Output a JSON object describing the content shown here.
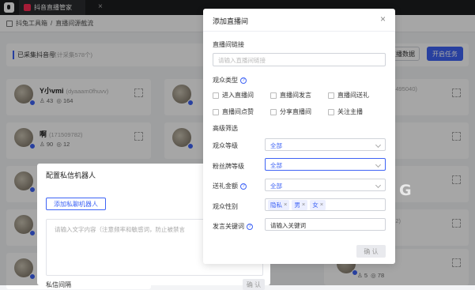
{
  "app": {
    "tab_title": "抖音直播管家",
    "close_label": "×"
  },
  "breadcrumb": {
    "root": "抖兔工具箱",
    "separator": "/",
    "current": "直播间源截流"
  },
  "collected": {
    "label": "已采集抖音号",
    "sub": "(累计采集578个)"
  },
  "toolbar": {
    "data_label": "直播数据",
    "start_label": "开启任务"
  },
  "users": [
    {
      "name": "Y小vmi",
      "id": "(dyaaam0fhuvv)",
      "stat1": "43",
      "stat2": "164"
    },
    {
      "name": "啊",
      "id": "(171509782)",
      "stat1": "90",
      "stat2": "12"
    },
    {
      "stat1": "5",
      "stat2": "78"
    }
  ],
  "right_ids": [
    "22495040)",
    "772)",
    "1)"
  ],
  "robot_dialog": {
    "title": "配置私信机器人",
    "add_label": "添加私聊机器人",
    "placeholder": "请输入文字内容（注意频率和敏感词，防止被禁言",
    "label": "私信间隔",
    "confirm": "确 认"
  },
  "live_dialog": {
    "title": "添加直播间",
    "close": "×",
    "link_label": "直播间链接",
    "link_placeholder": "请输入直播间链接",
    "audience_type_label": "观众类型",
    "help": "?",
    "types": [
      "进入直播间",
      "直播间发言",
      "直播间送礼",
      "直播间点赞",
      "分享直播间",
      "关注主播"
    ],
    "advanced_label": "高级筛选",
    "filters": {
      "level_label": "观众等级",
      "level_value": "全部",
      "fan_label": "粉丝牌等级",
      "fan_value": "全部",
      "gift_label": "送礼金额",
      "gift_value": "全部",
      "gender_label": "观众性别",
      "gender_tags": [
        "隐私",
        "男",
        "女"
      ],
      "tag_close": "×",
      "kw_label": "发言关键词",
      "kw_value": "请输入关键词"
    },
    "confirm": "确 认"
  },
  "watermark": "G",
  "colors": {
    "accent": "#3e63f5",
    "titlebar": "#1d1e20"
  }
}
